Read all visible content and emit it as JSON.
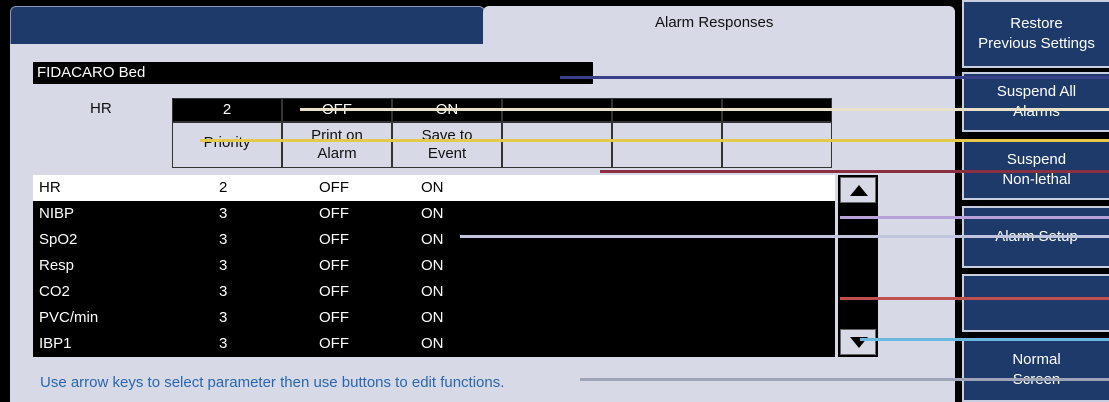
{
  "tab": {
    "title": "Alarm Responses"
  },
  "bed": {
    "name": "FIDACARO Bed"
  },
  "settings": {
    "parameter": "HR",
    "priority": "2",
    "print_on_alarm": "OFF",
    "save_to_event": "ON",
    "headers": {
      "priority": "Priority",
      "print_on_alarm_line1": "Print on",
      "print_on_alarm_line2": "Alarm",
      "save_to_event_line1": "Save to",
      "save_to_event_line2": "Event"
    }
  },
  "list": [
    {
      "name": "HR",
      "priority": "2",
      "print": "OFF",
      "save": "ON",
      "selected": true
    },
    {
      "name": "NIBP",
      "priority": "3",
      "print": "OFF",
      "save": "ON"
    },
    {
      "name": "SpO2",
      "priority": "3",
      "print": "OFF",
      "save": "ON"
    },
    {
      "name": "Resp",
      "priority": "3",
      "print": "OFF",
      "save": "ON"
    },
    {
      "name": "CO2",
      "priority": "3",
      "print": "OFF",
      "save": "ON"
    },
    {
      "name": "PVC/min",
      "priority": "3",
      "print": "OFF",
      "save": "ON"
    },
    {
      "name": "IBP1",
      "priority": "3",
      "print": "OFF",
      "save": "ON"
    }
  ],
  "hint": "Use arrow keys to select parameter then use buttons to edit functions.",
  "buttons": {
    "restore_line1": "Restore",
    "restore_line2": "Previous Settings",
    "suspend_all_line1": "Suspend All",
    "suspend_all_line2": "Alarms",
    "suspend_nonlethal_line1": "Suspend",
    "suspend_nonlethal_line2": "Non-lethal",
    "alarm_setup": "Alarm Setup",
    "normal_line1": "Normal",
    "normal_line2": "Screen"
  },
  "colors": {
    "navy": "#1e3a6a",
    "panel": "#d7d9e6",
    "hint": "#2866b0"
  },
  "icons": {
    "scroll_up": "triangle-up-icon",
    "scroll_down": "triangle-down-icon"
  }
}
